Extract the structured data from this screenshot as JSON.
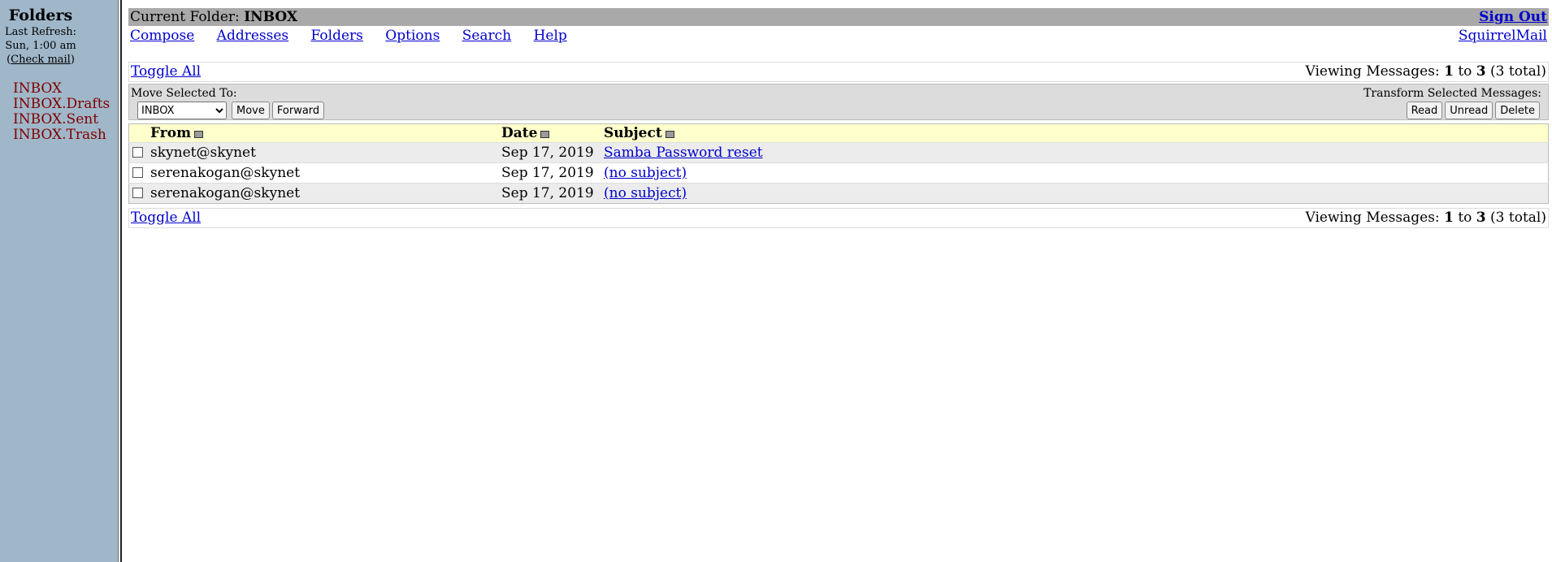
{
  "left": {
    "title": "Folders",
    "refresh_line1": "Last  Refresh:",
    "refresh_line2": "Sun,  1:00  am",
    "check_mail_open": "(",
    "check_mail": "Check mail",
    "check_mail_close": ")",
    "folders": [
      "INBOX",
      "INBOX.Drafts",
      "INBOX.Sent",
      "INBOX.Trash"
    ]
  },
  "header": {
    "current_folder_label": "Current Folder: ",
    "current_folder": "INBOX",
    "sign_out": "Sign Out"
  },
  "nav": {
    "items": [
      "Compose",
      "Addresses",
      "Folders",
      "Options",
      "Search",
      "Help"
    ],
    "brand": "SquirrelMail"
  },
  "pager": {
    "toggle_all": "Toggle All",
    "viewing_prefix": "Viewing Messages: ",
    "from": "1",
    "to_word": " to ",
    "to": "3",
    "total": " (3 total)"
  },
  "actions": {
    "move_label": "Move Selected To:",
    "folder_selected": "INBOX",
    "move_button": "Move",
    "forward_button": "Forward",
    "transform_label": "Transform Selected Messages:",
    "read_button": "Read",
    "unread_button": "Unread",
    "delete_button": "Delete"
  },
  "table": {
    "headers": {
      "from": "From",
      "date": "Date",
      "subject": "Subject"
    },
    "rows": [
      {
        "from": "skynet@skynet",
        "date": "Sep 17, 2019",
        "subject": "Samba Password reset"
      },
      {
        "from": "serenakogan@skynet",
        "date": "Sep 17, 2019",
        "subject": "(no subject)"
      },
      {
        "from": "serenakogan@skynet",
        "date": "Sep 17, 2019",
        "subject": "(no subject)"
      }
    ]
  },
  "colors": {
    "left_pane_bg": "#9fb7c9",
    "title_bar_bg": "#a9a9a9",
    "header_row_bg": "#ffffcc",
    "folder_link": "#800000",
    "link": "#0000cc"
  },
  "icons": {
    "sort": "sort-icon",
    "checkbox": "checkbox"
  }
}
